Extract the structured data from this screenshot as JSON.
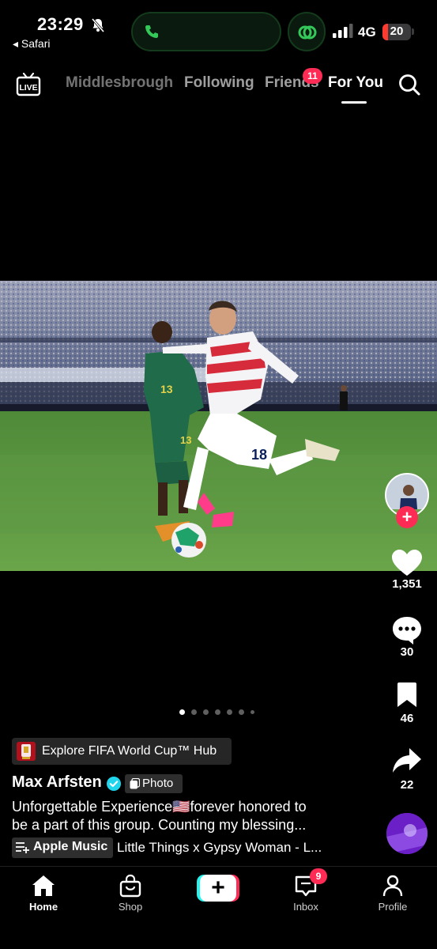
{
  "status_bar": {
    "time": "23:29",
    "back_app": "◂ Safari",
    "network": "4G",
    "battery_level": "20",
    "battery_percent": 20,
    "signal_bars_active": 3,
    "signal_bars_total": 4
  },
  "top_nav": {
    "live_label": "LIVE",
    "tabs": [
      "Middlesbrough",
      "Following",
      "Friends",
      "For You"
    ],
    "active_tab": "For You",
    "friends_badge": "11"
  },
  "carousel": {
    "total": 7,
    "current": 1
  },
  "actions": {
    "likes": "1,351",
    "comments": "30",
    "saves": "46",
    "shares": "22"
  },
  "post": {
    "hub_chip": "Explore FIFA World Cup™ Hub",
    "author": "Max Arfsten",
    "verified": true,
    "type_tag": "Photo",
    "caption_line1": "Unforgettable Experience🇺🇸forever honored to",
    "caption_line2": "be a part of this group. Counting my blessing...",
    "music_chip": "Apple Music",
    "track": "Little Things x Gypsy Woman - L..."
  },
  "tabbar": {
    "home": "Home",
    "shop": "Shop",
    "inbox": "Inbox",
    "profile": "Profile",
    "inbox_badge": "9"
  },
  "colors": {
    "accent": "#fe2c55",
    "cyan": "#25f4ee",
    "call_green": "#34c759",
    "verified_blue": "#20d5ec"
  }
}
